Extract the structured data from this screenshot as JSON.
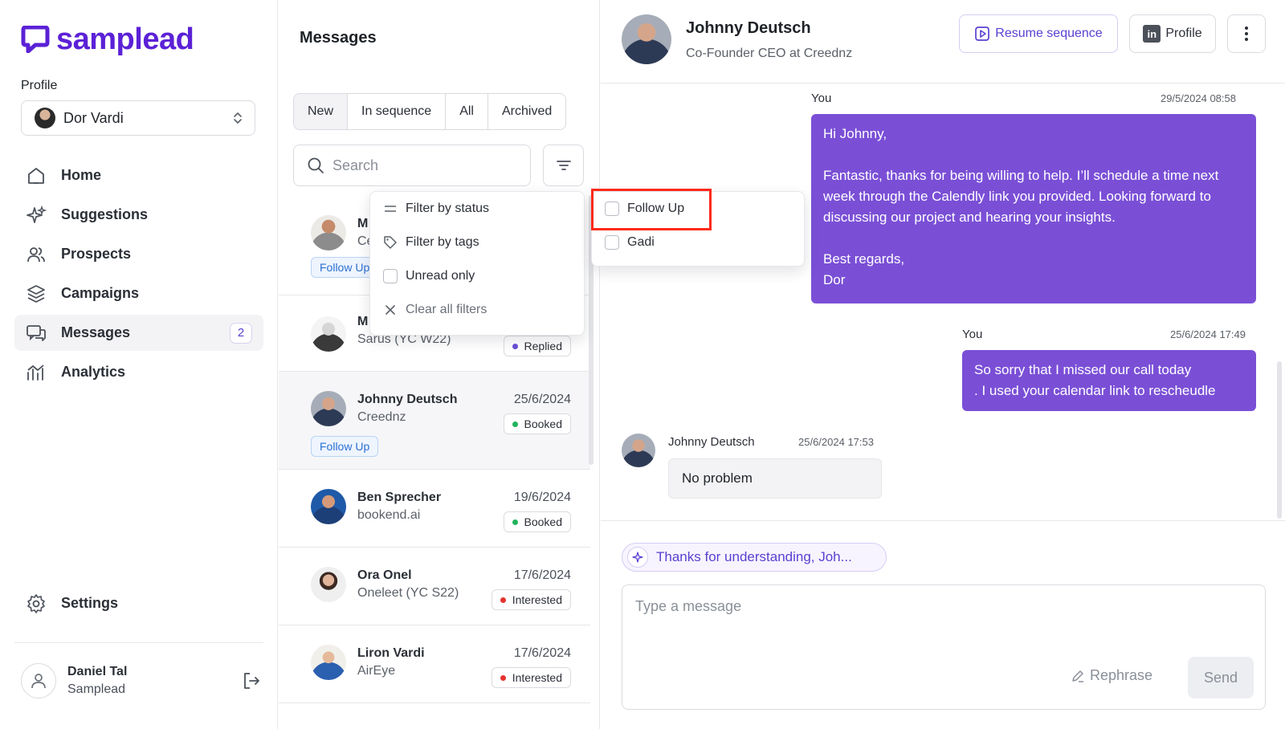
{
  "sidebar": {
    "brand": "samplead",
    "profile_label": "Profile",
    "profile_name": "Dor Vardi",
    "nav": [
      {
        "label": "Home",
        "icon": "home-icon"
      },
      {
        "label": "Suggestions",
        "icon": "sparkles-icon"
      },
      {
        "label": "Prospects",
        "icon": "users-icon"
      },
      {
        "label": "Campaigns",
        "icon": "layers-icon"
      },
      {
        "label": "Messages",
        "icon": "chat-icon",
        "badge": "2",
        "active": true
      },
      {
        "label": "Analytics",
        "icon": "analytics-icon"
      }
    ],
    "settings_label": "Settings",
    "user": {
      "name": "Daniel Tal",
      "org": "Samplead"
    }
  },
  "messages_panel": {
    "title": "Messages",
    "tabs": [
      "New",
      "In sequence",
      "All",
      "Archived"
    ],
    "active_tab": "New",
    "search_placeholder": "Search",
    "conversations": [
      {
        "name": "M",
        "company": "Ce",
        "tag": "Follow Up"
      },
      {
        "name": "M",
        "company": "Sarus (YC W22)",
        "status": "Replied",
        "status_color": "#6b4fd8"
      },
      {
        "name": "Johnny Deutsch",
        "company": "Creednz",
        "date": "25/6/2024",
        "status": "Booked",
        "status_color": "#22b35e",
        "tag": "Follow Up",
        "selected": true
      },
      {
        "name": "Ben Sprecher",
        "company": "bookend.ai",
        "date": "19/6/2024",
        "status": "Booked",
        "status_color": "#22b35e"
      },
      {
        "name": "Ora Onel",
        "company": "Oneleet (YC S22)",
        "date": "17/6/2024",
        "status": "Interested",
        "status_color": "#e5322d"
      },
      {
        "name": "Liron Vardi",
        "company": "AirEye",
        "date": "17/6/2024",
        "status": "Interested",
        "status_color": "#e5322d"
      }
    ]
  },
  "filter_menu": {
    "items": [
      "Filter by status",
      "Filter by tags",
      "Unread only",
      "Clear all filters"
    ]
  },
  "tag_menu": {
    "items": [
      "Follow Up",
      "Gadi"
    ],
    "highlighted": "Follow Up"
  },
  "chat": {
    "contact_name": "Johnny Deutsch",
    "contact_role": "Co-Founder CEO at Creednz",
    "resume_label": "Resume sequence",
    "profile_label": "Profile",
    "linkedin_glyph": "in",
    "messages": [
      {
        "from": "You",
        "time": "29/5/2024 08:58",
        "text": "Hi Johnny,\n\nFantastic, thanks for being willing to help. I’ll schedule a time next week through the Calendly link you provided. Looking forward to discussing our project and hearing your insights.\n\nBest regards,\nDor"
      },
      {
        "from": "You",
        "time": "25/6/2024 17:49",
        "text": "So sorry that I missed our call today\n. I used your calendar link to rescheudle"
      },
      {
        "from": "Johnny Deutsch",
        "time": "25/6/2024 17:53",
        "text": "No problem"
      }
    ],
    "suggestion": "Thanks for understanding, Joh...",
    "composer_placeholder": "Type a message",
    "rephrase_label": "Rephrase",
    "send_label": "Send"
  },
  "colors": {
    "brand": "#5b21d6",
    "outgoing_bubble": "#7a4fd6",
    "highlight": "#ff2a1a"
  }
}
